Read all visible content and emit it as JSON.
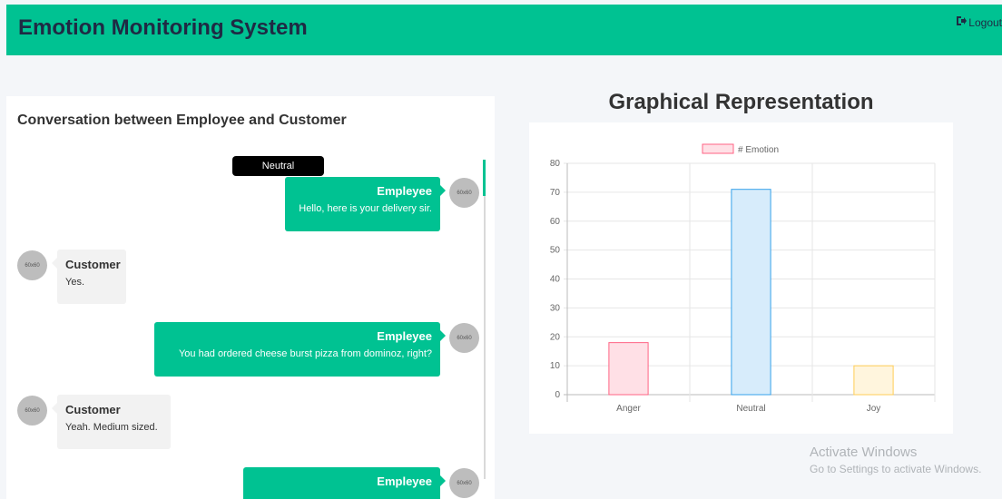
{
  "header": {
    "title": "Emotion Monitoring System",
    "logout_label": "Logout"
  },
  "conversation": {
    "title": "Conversation between Employee and Customer",
    "tag": "Neutral",
    "avatar_label": "60x60",
    "messages": [
      {
        "side": "employee",
        "sender": "Empleyee",
        "text": "Hello, here is your delivery sir."
      },
      {
        "side": "customer",
        "sender": "Customer",
        "text": "Yes."
      },
      {
        "side": "employee",
        "sender": "Empleyee",
        "text": "You had ordered cheese burst pizza from dominoz, right?"
      },
      {
        "side": "customer",
        "sender": "Customer",
        "text": "Yeah. Medium sized."
      },
      {
        "side": "employee",
        "sender": "Empleyee",
        "text": ""
      }
    ]
  },
  "graph": {
    "heading": "Graphical Representation"
  },
  "chart_data": {
    "type": "bar",
    "categories": [
      "Anger",
      "Neutral",
      "Joy"
    ],
    "series": [
      {
        "name": "# Emotion",
        "values": [
          18,
          71,
          10
        ]
      }
    ],
    "ylim": [
      0,
      80
    ],
    "yticks": [
      0,
      10,
      20,
      30,
      40,
      50,
      60,
      70,
      80
    ],
    "grid": true,
    "legend": "top-center",
    "fill_colors": [
      "#ffe0e6",
      "#d7ecfb",
      "#fff5dd"
    ],
    "border_colors": [
      "#ff6384",
      "#36a2eb",
      "#ffcd56"
    ]
  },
  "watermark": {
    "line1": "Activate Windows",
    "line2": "Go to Settings to activate Windows."
  },
  "colors": {
    "accent": "#00c292",
    "tag_bg": "#000000"
  }
}
